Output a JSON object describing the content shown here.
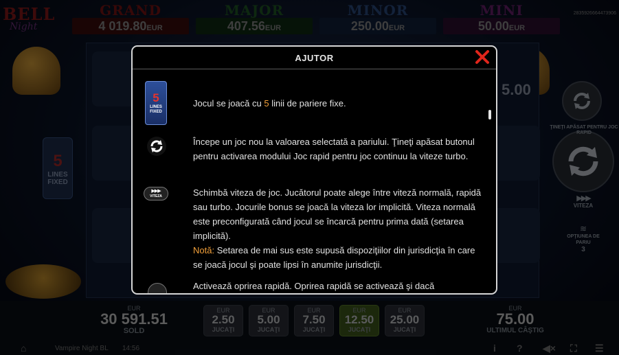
{
  "logo": {
    "line1": "BELL",
    "line2": "Night"
  },
  "jackpots": [
    {
      "name": "GRAND",
      "value": "4 019.80",
      "currency": "EUR"
    },
    {
      "name": "MAJOR",
      "value": "407.56",
      "currency": "EUR"
    },
    {
      "name": "MINOR",
      "value": "250.00",
      "currency": "EUR"
    },
    {
      "name": "MINI",
      "value": "50.00",
      "currency": "EUR"
    }
  ],
  "session_id": "2835926664473906",
  "left_badge": {
    "number": "5",
    "line1": "LINES",
    "line2": "FIXED"
  },
  "right_panel": {
    "partial_value": "5.00",
    "turbo_hint": "ŢINEŢI APĂSAT PENTRU JOC RAPID",
    "speed_label": "VITEZA",
    "bet_options_label": "OPŢIUNEA DE PARIU",
    "bet_options_count": "3"
  },
  "modal": {
    "title": "AJUTOR",
    "items": [
      {
        "icon": "lines-fixed-icon",
        "icon_num": "5",
        "icon_l1": "LINES",
        "icon_l2": "FIXED",
        "pre": "Jocul se joacă cu ",
        "highlight": "5",
        "post": " linii de pariere fixe."
      },
      {
        "icon": "refresh-icon",
        "text": "Începe un joc nou la valoarea selectată a pariului. Ţineţi apăsat butonul pentru activarea modului Joc rapid pentru joc continuu la viteze turbo."
      },
      {
        "icon": "speed-icon",
        "icon_label": "VITEZA",
        "text": "Schimbă viteza de joc. Jucătorul poate alege între viteză normală, rapidă sau turbo. Jocurile bonus se joacă la viteza lor implicită. Viteza normală este preconfigurată când jocul se încarcă pentru prima dată (setarea implicită).",
        "note_label": "Notă:",
        "note_text": " Setarea de mai sus este supusă dispoziţiilor din jurisdicţia în care se joacă jocul şi poate lipsi în anumite jurisdicţii."
      },
      {
        "icon": "stop-icon",
        "text": "Activează oprirea rapidă. Oprirea rapidă se activează şi dacă"
      }
    ]
  },
  "bottom": {
    "credit": {
      "currency": "EUR",
      "amount": "30 591.51",
      "label": "SOLD"
    },
    "bets": [
      {
        "currency": "EUR",
        "amount": "2.50",
        "label": "JUCAŢI"
      },
      {
        "currency": "EUR",
        "amount": "5.00",
        "label": "JUCAŢI"
      },
      {
        "currency": "EUR",
        "amount": "7.50",
        "label": "JUCAŢI"
      },
      {
        "currency": "EUR",
        "amount": "12.50",
        "label": "JUCAŢI"
      },
      {
        "currency": "EUR",
        "amount": "25.00",
        "label": "JUCAŢI"
      }
    ],
    "active_bet_index": 3,
    "last_win": {
      "currency": "EUR",
      "amount": "75.00",
      "label": "ULTIMUL CÂŞTIG"
    },
    "game_name": "Vampire Night BL",
    "time": "14:56"
  },
  "colors": {
    "accent": "#f2a03a",
    "close": "#e0251b",
    "active_bet": "#3f5a1c"
  }
}
